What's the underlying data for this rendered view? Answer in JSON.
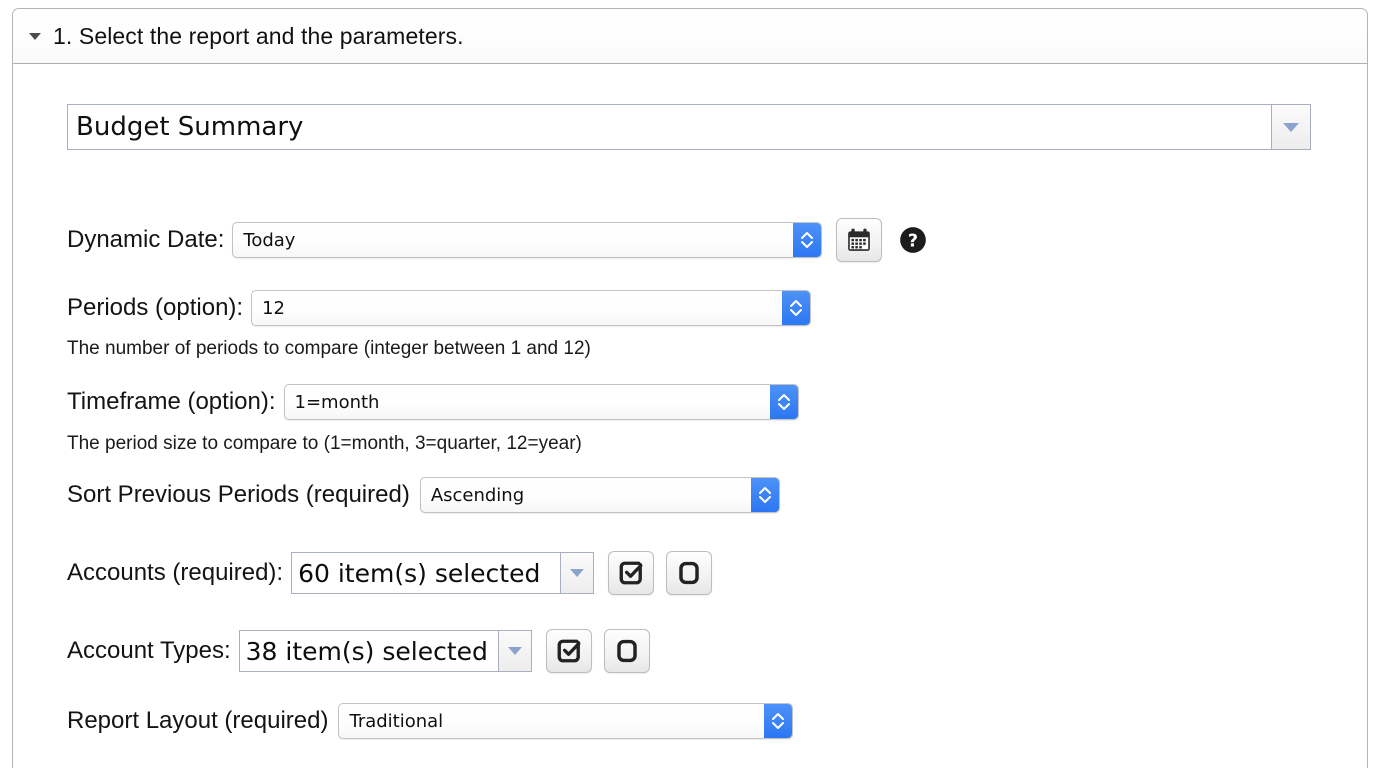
{
  "panel": {
    "step_title": "1. Select the report and the parameters.",
    "disclosure_icon": "triangle-down-icon"
  },
  "report_picker": {
    "value": "Budget Summary",
    "dropdown_icon": "triangle-down-icon"
  },
  "fields": {
    "dynamic_date": {
      "label": "Dynamic Date:",
      "value": "Today",
      "calendar_icon": "calendar-icon",
      "help_icon": "help-circle-icon"
    },
    "periods": {
      "label": "Periods (option):",
      "value": "12",
      "hint": "The number of periods to compare (integer between 1 and 12)"
    },
    "timeframe": {
      "label": "Timeframe (option):",
      "value": "1=month",
      "hint": "The period size to compare to (1=month, 3=quarter, 12=year)"
    },
    "sort_previous_periods": {
      "label": "Sort Previous Periods (required)",
      "value": "Ascending"
    },
    "accounts": {
      "label": "Accounts (required):",
      "value": "60 item(s) selected",
      "dropdown_icon": "triangle-down-icon",
      "select_all_icon": "checkbox-checked-icon",
      "deselect_all_icon": "checkbox-empty-icon"
    },
    "account_types": {
      "label": "Account Types:",
      "value": "38 item(s) selected",
      "dropdown_icon": "triangle-down-icon",
      "select_all_icon": "checkbox-checked-icon",
      "deselect_all_icon": "checkbox-empty-icon"
    },
    "report_layout": {
      "label": "Report Layout (required)",
      "value": "Traditional"
    }
  },
  "colors": {
    "select_button_blue": "#2c77f3",
    "combo_arrow": "#8ba4cd",
    "panel_border": "#b4b4b4",
    "text": "#111111"
  }
}
